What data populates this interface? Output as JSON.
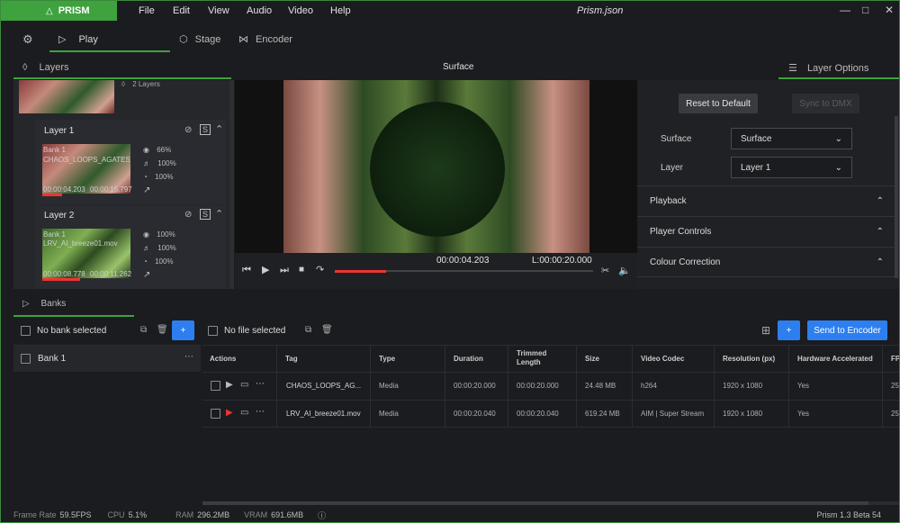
{
  "app": {
    "logo": "PRISM",
    "title": "Prism.json",
    "menu": [
      "File",
      "Edit",
      "View",
      "Audio",
      "Video",
      "Help"
    ]
  },
  "tabs": {
    "play": "Play",
    "stage": "Stage",
    "encoder": "Encoder"
  },
  "panels": {
    "layers": "Layers",
    "surface": "Surface",
    "layer_options": "Layer Options",
    "banks": "Banks"
  },
  "layers": {
    "group_count": "2 Layers",
    "items": [
      {
        "name": "Layer 1",
        "bank": "Bank 1",
        "clip": "CHAOS_LOOPS_AGATES",
        "time_pos": "00:00:04.203",
        "time_end": "00:00:15.797",
        "opacity": "66%",
        "volume": "100%",
        "speed": "100%"
      },
      {
        "name": "Layer 2",
        "bank": "Bank 1",
        "clip": "LRV_AI_breeze01.mov",
        "time_pos": "00:00:08.778",
        "time_end": "00:00:11.262",
        "opacity": "100%",
        "volume": "100%",
        "speed": "100%"
      }
    ]
  },
  "transport": {
    "current": "00:00:04.203",
    "length": "L:00:00:20.000",
    "progress": 0.2
  },
  "options": {
    "reset": "Reset to Default",
    "sync": "Sync to DMX",
    "surface_label": "Surface",
    "surface_value": "Surface",
    "layer_label": "Layer",
    "layer_value": "Layer 1",
    "sections": [
      "Playback",
      "Player Controls",
      "Colour Correction"
    ]
  },
  "banks": {
    "no_bank": "No bank selected",
    "no_file": "No file selected",
    "send": "Send to Encoder",
    "plus": "+",
    "bank_list": [
      "Bank 1"
    ]
  },
  "table": {
    "headers": [
      "Actions",
      "Tag",
      "Type",
      "Duration",
      "Trimmed Length",
      "Size",
      "Video Codec",
      "Resolution (px)",
      "Hardware Accelerated",
      "FP"
    ],
    "rows": [
      {
        "tag": "CHAOS_LOOPS_AG...",
        "type": "Media",
        "duration": "00:00:20.000",
        "trimmed": "00:00:20.000",
        "size": "24.48 MB",
        "codec": "h264",
        "resolution": "1920 x 1080",
        "hw": "Yes",
        "fp": "25"
      },
      {
        "tag": "LRV_AI_breeze01.mov",
        "type": "Media",
        "duration": "00:00:20.040",
        "trimmed": "00:00:20.040",
        "size": "619.24 MB",
        "codec": "AIM | Super Stream",
        "resolution": "1920 x 1080",
        "hw": "Yes",
        "fp": "25"
      }
    ]
  },
  "status": {
    "fps_label": "Frame Rate",
    "fps": "59.5FPS",
    "cpu_label": "CPU",
    "cpu": "5.1%",
    "ram_label": "RAM",
    "ram": "296.2MB",
    "vram_label": "VRAM",
    "vram": "691.6MB",
    "version": "Prism 1.3 Beta 54"
  },
  "colors": {
    "accent": "#3ea23e",
    "blue": "#2d7ff0",
    "red": "#e33333"
  }
}
